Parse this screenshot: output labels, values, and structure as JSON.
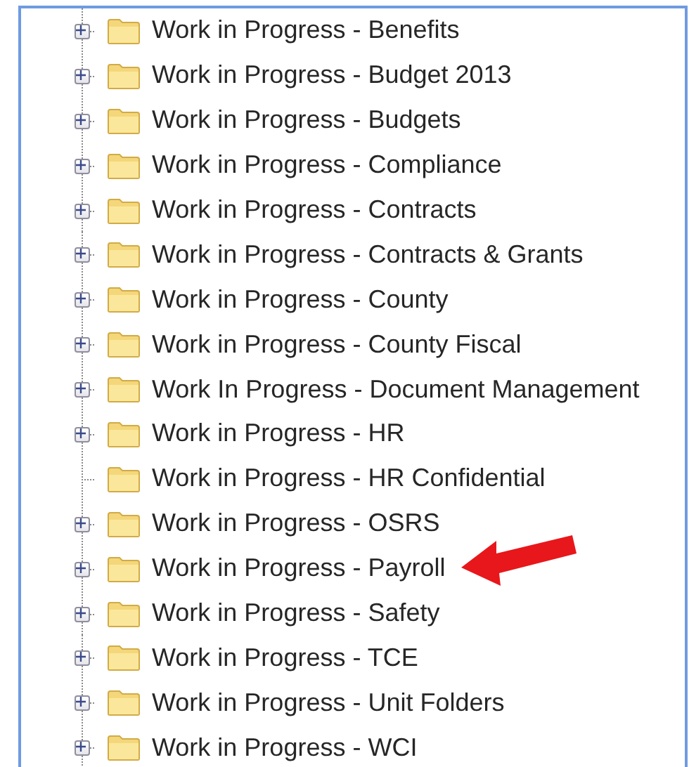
{
  "folder_tree": {
    "items": [
      {
        "label": "Work in Progress - Benefits",
        "has_children": true,
        "marked": false
      },
      {
        "label": "Work in Progress - Budget 2013",
        "has_children": true,
        "marked": false
      },
      {
        "label": "Work in Progress - Budgets",
        "has_children": true,
        "marked": false
      },
      {
        "label": "Work in Progress - Compliance",
        "has_children": true,
        "marked": false
      },
      {
        "label": "Work in Progress - Contracts",
        "has_children": true,
        "marked": false
      },
      {
        "label": "Work in Progress - Contracts & Grants",
        "has_children": true,
        "marked": false
      },
      {
        "label": "Work in Progress - County",
        "has_children": true,
        "marked": false
      },
      {
        "label": "Work in Progress - County Fiscal",
        "has_children": true,
        "marked": false
      },
      {
        "label": "Work In Progress - Document Management",
        "has_children": true,
        "marked": false
      },
      {
        "label": "Work in Progress - HR",
        "has_children": true,
        "marked": false
      },
      {
        "label": "Work in Progress - HR Confidential",
        "has_children": false,
        "marked": false
      },
      {
        "label": "Work in Progress - OSRS",
        "has_children": true,
        "marked": false
      },
      {
        "label": "Work in Progress - Payroll",
        "has_children": true,
        "marked": true
      },
      {
        "label": "Work in Progress - Safety",
        "has_children": true,
        "marked": false
      },
      {
        "label": "Work in Progress - TCE",
        "has_children": true,
        "marked": false
      },
      {
        "label": "Work in Progress - Unit Folders",
        "has_children": true,
        "marked": false
      },
      {
        "label": "Work in Progress - WCI",
        "has_children": true,
        "marked": false
      }
    ]
  }
}
